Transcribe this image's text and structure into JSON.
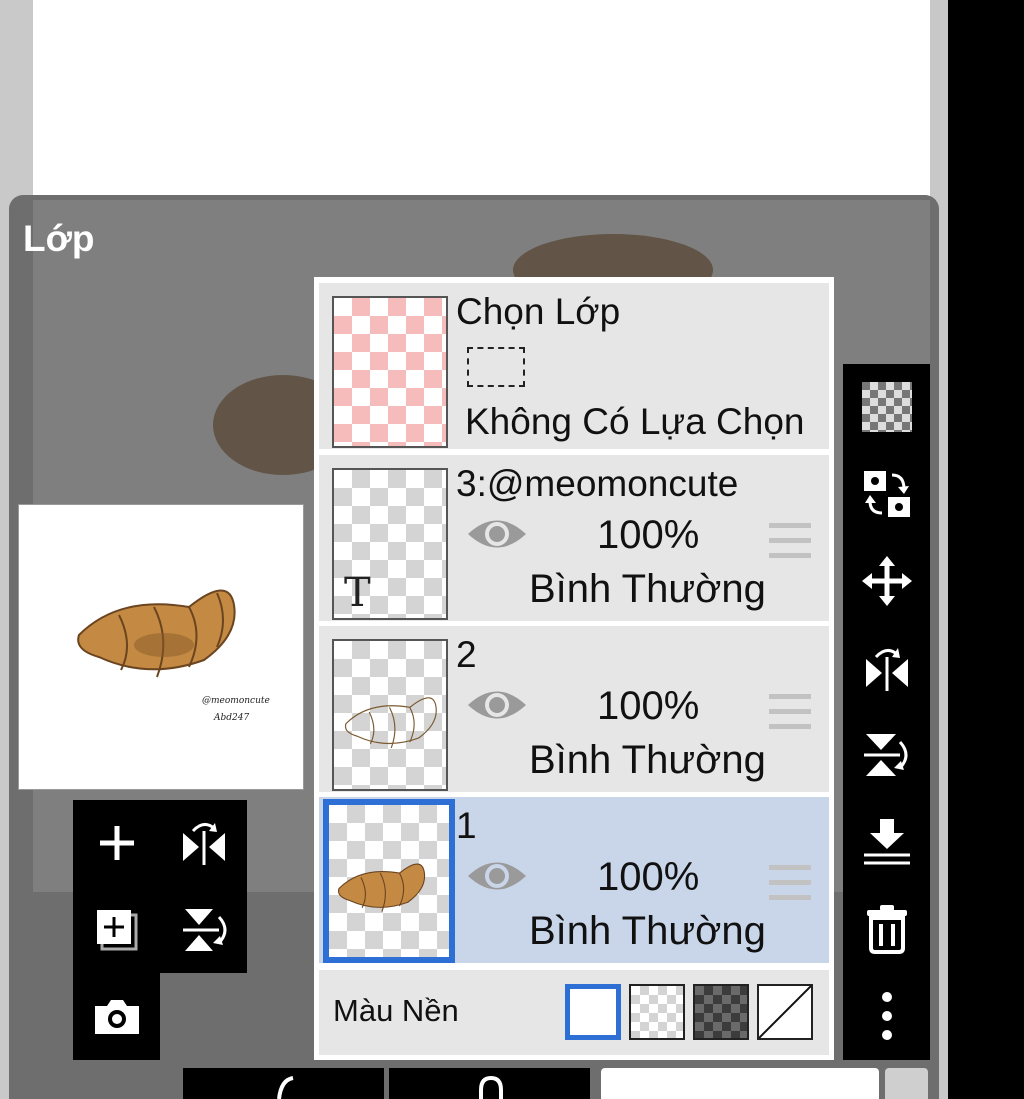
{
  "panel": {
    "title": "Lớp"
  },
  "preview": {
    "signature_line1": "@meomoncute",
    "signature_line2": "Abd247"
  },
  "selection_row": {
    "name": "Chọn Lớp",
    "status": "Không Có Lựa Chọn"
  },
  "layers": [
    {
      "name": "3:@meomoncute",
      "opacity": "100%",
      "blend": "Bình Thường",
      "type": "text",
      "thumb_text": "T",
      "visible": true
    },
    {
      "name": "2",
      "opacity": "100%",
      "blend": "Bình Thường",
      "type": "line-art",
      "visible": true
    },
    {
      "name": "1",
      "opacity": "100%",
      "blend": "Bình Thường",
      "type": "color",
      "visible": true,
      "selected": true
    }
  ],
  "background": {
    "label": "Màu Nền",
    "options": [
      "white",
      "transparent",
      "dark-checker",
      "none"
    ],
    "selected": "white"
  },
  "left_tools": [
    "add-layer-icon",
    "flip-horizontal-icon",
    "add-copy-icon",
    "flip-vertical-icon",
    "camera-icon"
  ],
  "right_tools": [
    "transparency-icon",
    "swap-icon",
    "move-icon",
    "flip-horizontal-icon",
    "flip-vertical-icon",
    "merge-down-icon",
    "trash-icon",
    "more-icon"
  ],
  "colors": {
    "accent": "#2d6fd4",
    "selected_row": "#c9d6ea",
    "row": "#e6e6e6",
    "panel": "#6e6e6e"
  }
}
